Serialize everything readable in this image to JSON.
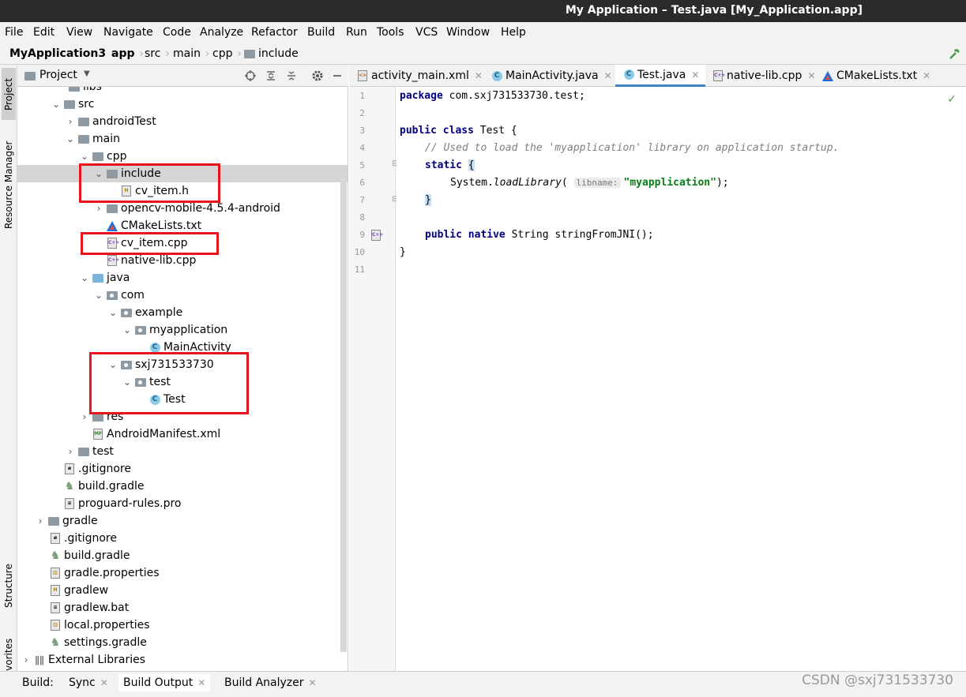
{
  "window": {
    "title": "My Application – Test.java [My_Application.app]"
  },
  "menu": [
    "File",
    "Edit",
    "View",
    "Navigate",
    "Code",
    "Analyze",
    "Refactor",
    "Build",
    "Run",
    "Tools",
    "VCS",
    "Window",
    "Help"
  ],
  "breadcrumbs": [
    "MyApplication3",
    "app",
    "src",
    "main",
    "cpp",
    "include"
  ],
  "side_tabs": {
    "project": "Project",
    "resource_manager": "Resource Manager",
    "structure": "Structure",
    "favorites": "Favorites"
  },
  "project_panel": {
    "title": "Project",
    "tree": [
      {
        "label": "libs",
        "icon": "folder-icon"
      },
      {
        "label": "src",
        "icon": "folder-icon"
      },
      {
        "label": "androidTest",
        "icon": "folder-icon"
      },
      {
        "label": "main",
        "icon": "folder-icon"
      },
      {
        "label": "cpp",
        "icon": "folder-icon"
      },
      {
        "label": "include",
        "icon": "folder-icon",
        "selected": true
      },
      {
        "label": "cv_item.h",
        "icon": "header-file-icon"
      },
      {
        "label": "opencv-mobile-4.5.4-android",
        "icon": "folder-icon"
      },
      {
        "label": "CMakeLists.txt",
        "icon": "cmake-icon"
      },
      {
        "label": "cv_item.cpp",
        "icon": "cpp-file-icon"
      },
      {
        "label": "native-lib.cpp",
        "icon": "cpp-file-icon"
      },
      {
        "label": "java",
        "icon": "source-folder-icon"
      },
      {
        "label": "com",
        "icon": "package-icon"
      },
      {
        "label": "example",
        "icon": "package-icon"
      },
      {
        "label": "myapplication",
        "icon": "package-icon"
      },
      {
        "label": "MainActivity",
        "icon": "class-icon"
      },
      {
        "label": "sxj731533730",
        "icon": "package-icon"
      },
      {
        "label": "test",
        "icon": "package-icon"
      },
      {
        "label": "Test",
        "icon": "class-icon"
      },
      {
        "label": "res",
        "icon": "resources-folder-icon"
      },
      {
        "label": "AndroidManifest.xml",
        "icon": "manifest-icon"
      },
      {
        "label": "test",
        "icon": "folder-icon"
      },
      {
        "label": ".gitignore",
        "icon": "gitignore-icon"
      },
      {
        "label": "build.gradle",
        "icon": "gradle-icon"
      },
      {
        "label": "proguard-rules.pro",
        "icon": "text-file-icon"
      },
      {
        "label": "gradle",
        "icon": "folder-icon"
      },
      {
        "label": ".gitignore",
        "icon": "gitignore-icon"
      },
      {
        "label": "build.gradle",
        "icon": "gradle-icon"
      },
      {
        "label": "gradle.properties",
        "icon": "properties-icon"
      },
      {
        "label": "gradlew",
        "icon": "shell-script-icon"
      },
      {
        "label": "gradlew.bat",
        "icon": "batch-file-icon"
      },
      {
        "label": "local.properties",
        "icon": "properties-icon"
      },
      {
        "label": "settings.gradle",
        "icon": "gradle-icon"
      },
      {
        "label": "External Libraries",
        "icon": "library-icon"
      }
    ]
  },
  "editor": {
    "tabs": [
      {
        "label": "activity_main.xml",
        "icon": "xml-layout-icon"
      },
      {
        "label": "MainActivity.java",
        "icon": "class-icon"
      },
      {
        "label": "Test.java",
        "icon": "class-icon",
        "active": true
      },
      {
        "label": "native-lib.cpp",
        "icon": "cpp-file-icon"
      },
      {
        "label": "CMakeLists.txt",
        "icon": "cmake-icon"
      }
    ],
    "line_numbers": [
      "1",
      "2",
      "3",
      "4",
      "5",
      "6",
      "7",
      "8",
      "9",
      "10",
      "11"
    ],
    "code": {
      "l1_kw": "package",
      "l1_rest": " com.sxj731533730.test;",
      "l3_kw": "public class",
      "l3_rest": " Test {",
      "l4": "// Used to load the 'myapplication' library on application startup.",
      "l5_kw": "static",
      "l5_br": "{",
      "l6_obj": "System.",
      "l6_method": "loadLibrary",
      "l6_paren": "(",
      "l6_hint": "libname:",
      "l6_str": "\"myapplication\"",
      "l6_end": ");",
      "l7_br": "}",
      "l9_kw": "public native",
      "l9_rest": " String stringFromJNI();",
      "l10": "}"
    }
  },
  "bottom": {
    "build_label": "Build:",
    "tabs": [
      "Sync",
      "Build Output",
      "Build Analyzer"
    ],
    "active_tab": "Build Output"
  },
  "watermark": "CSDN @sxj731533730",
  "colors": {
    "highlight_box": "#e8141d",
    "selection": "#d5d5d5",
    "active_tab_underline": "#4083c9"
  }
}
